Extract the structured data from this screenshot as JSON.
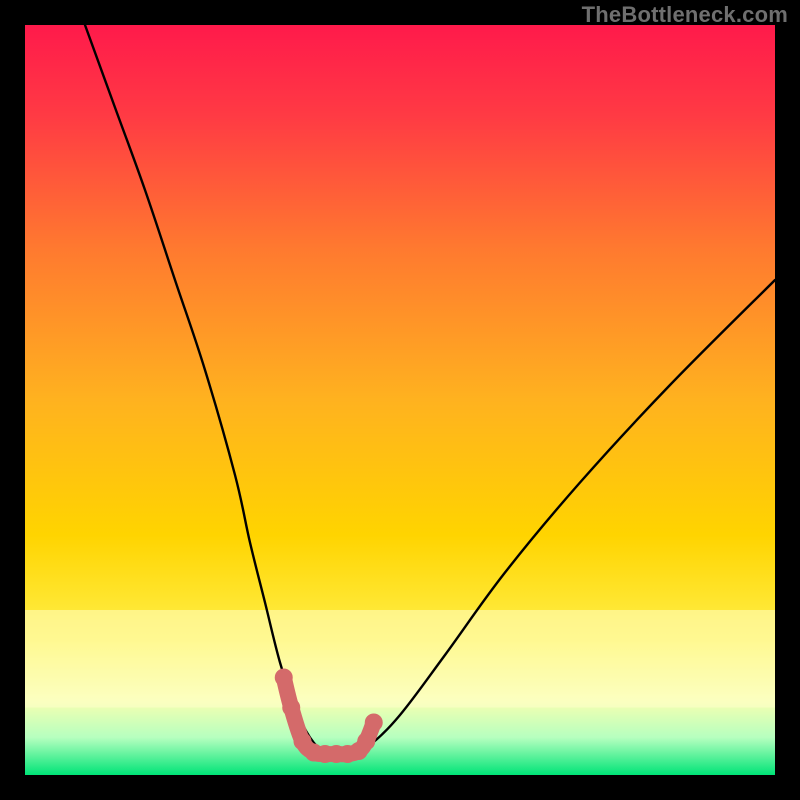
{
  "attribution": "TheBottleneck.com",
  "chart_data": {
    "type": "line",
    "title": "",
    "xlabel": "",
    "ylabel": "",
    "xlim": [
      0,
      100
    ],
    "ylim": [
      0,
      100
    ],
    "gradient_top_color": "#ff1a4b",
    "gradient_mid_color": "#ffd400",
    "gradient_bottom_band_color": "#00e477",
    "marker_color": "#d46a6a",
    "curve_stroke": "#000000",
    "series": [
      {
        "name": "bottleneck-curve",
        "x": [
          8,
          12,
          16,
          20,
          24,
          28,
          30,
          32,
          34,
          36,
          38,
          40,
          42,
          44,
          46,
          50,
          56,
          64,
          74,
          86,
          100
        ],
        "y": [
          100,
          89,
          78,
          66,
          54,
          40,
          31,
          23,
          15,
          9,
          5,
          3,
          3,
          3,
          4,
          8,
          16,
          27,
          39,
          52,
          66
        ]
      }
    ],
    "markers": {
      "x": [
        34.5,
        35.5,
        37.0,
        38.5,
        40.0,
        41.5,
        43.0,
        44.5,
        45.5,
        46.5
      ],
      "y": [
        13.0,
        9.0,
        4.5,
        3.0,
        2.8,
        2.8,
        2.8,
        3.2,
        4.5,
        7.0
      ]
    }
  }
}
